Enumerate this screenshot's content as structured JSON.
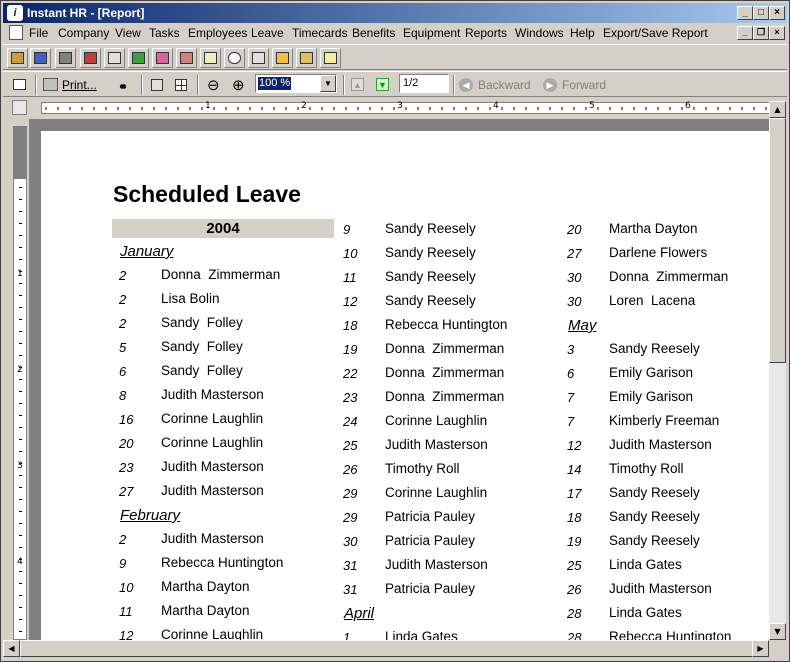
{
  "window": {
    "title": "Instant HR - [Report]",
    "app_icon": "app-logo-icon"
  },
  "menu": [
    "File",
    "Company",
    "View",
    "Tasks",
    "Employees",
    "Leave",
    "Timecards",
    "Benefits",
    "Equipment",
    "Reports",
    "Windows",
    "Help",
    "Export/Save Report"
  ],
  "toolbar2": {
    "print_label": "Print...",
    "zoom_value": "100 %",
    "page_value": "1/2",
    "backward_label": "Backward",
    "forward_label": "Forward"
  },
  "ruler": [
    "1",
    "2",
    "3",
    "4",
    "5",
    "6"
  ],
  "report": {
    "title": "Scheduled Leave",
    "year": "2004",
    "columns": [
      [
        {
          "type": "month",
          "label": "January"
        },
        {
          "d": "2",
          "n": "Donna  Zimmerman"
        },
        {
          "d": "2",
          "n": "Lisa Bolin"
        },
        {
          "d": "2",
          "n": "Sandy  Folley"
        },
        {
          "d": "5",
          "n": "Sandy  Folley"
        },
        {
          "d": "6",
          "n": "Sandy  Folley"
        },
        {
          "d": "8",
          "n": "Judith Masterson"
        },
        {
          "d": "16",
          "n": "Corinne Laughlin"
        },
        {
          "d": "20",
          "n": "Corinne Laughlin"
        },
        {
          "d": "23",
          "n": "Judith Masterson"
        },
        {
          "d": "27",
          "n": "Judith Masterson"
        },
        {
          "type": "month",
          "label": "February"
        },
        {
          "d": "2",
          "n": "Judith Masterson"
        },
        {
          "d": "9",
          "n": "Rebecca Huntington"
        },
        {
          "d": "10",
          "n": "Martha Dayton"
        },
        {
          "d": "11",
          "n": "Martha Dayton"
        },
        {
          "d": "12",
          "n": "Corinne Laughlin"
        }
      ],
      [
        {
          "d": "9",
          "n": "Sandy Reesely"
        },
        {
          "d": "10",
          "n": "Sandy Reesely"
        },
        {
          "d": "11",
          "n": "Sandy Reesely"
        },
        {
          "d": "12",
          "n": "Sandy Reesely"
        },
        {
          "d": "18",
          "n": "Rebecca Huntington"
        },
        {
          "d": "19",
          "n": "Donna  Zimmerman"
        },
        {
          "d": "22",
          "n": "Donna  Zimmerman"
        },
        {
          "d": "23",
          "n": "Donna  Zimmerman"
        },
        {
          "d": "24",
          "n": "Corinne Laughlin"
        },
        {
          "d": "25",
          "n": "Judith Masterson"
        },
        {
          "d": "26",
          "n": "Timothy Roll"
        },
        {
          "d": "29",
          "n": "Corinne Laughlin"
        },
        {
          "d": "29",
          "n": "Patricia Pauley"
        },
        {
          "d": "30",
          "n": "Patricia Pauley"
        },
        {
          "d": "31",
          "n": "Judith Masterson"
        },
        {
          "d": "31",
          "n": "Patricia Pauley"
        },
        {
          "type": "month",
          "label": "April"
        },
        {
          "d": "1",
          "n": "Linda Gates"
        }
      ],
      [
        {
          "d": "20",
          "n": "Martha Dayton"
        },
        {
          "d": "27",
          "n": "Darlene Flowers"
        },
        {
          "d": "30",
          "n": "Donna  Zimmerman"
        },
        {
          "d": "30",
          "n": "Loren  Lacena"
        },
        {
          "type": "month",
          "label": "May"
        },
        {
          "d": "3",
          "n": "Sandy Reesely"
        },
        {
          "d": "6",
          "n": "Emily Garison"
        },
        {
          "d": "7",
          "n": "Emily Garison"
        },
        {
          "d": "7",
          "n": "Kimberly Freeman"
        },
        {
          "d": "12",
          "n": "Judith Masterson"
        },
        {
          "d": "14",
          "n": "Timothy Roll"
        },
        {
          "d": "17",
          "n": "Sandy Reesely"
        },
        {
          "d": "18",
          "n": "Sandy Reesely"
        },
        {
          "d": "19",
          "n": "Sandy Reesely"
        },
        {
          "d": "25",
          "n": "Linda Gates"
        },
        {
          "d": "26",
          "n": "Judith Masterson"
        },
        {
          "d": "28",
          "n": "Linda Gates"
        },
        {
          "d": "28",
          "n": "Rebecca Huntington"
        }
      ]
    ]
  }
}
